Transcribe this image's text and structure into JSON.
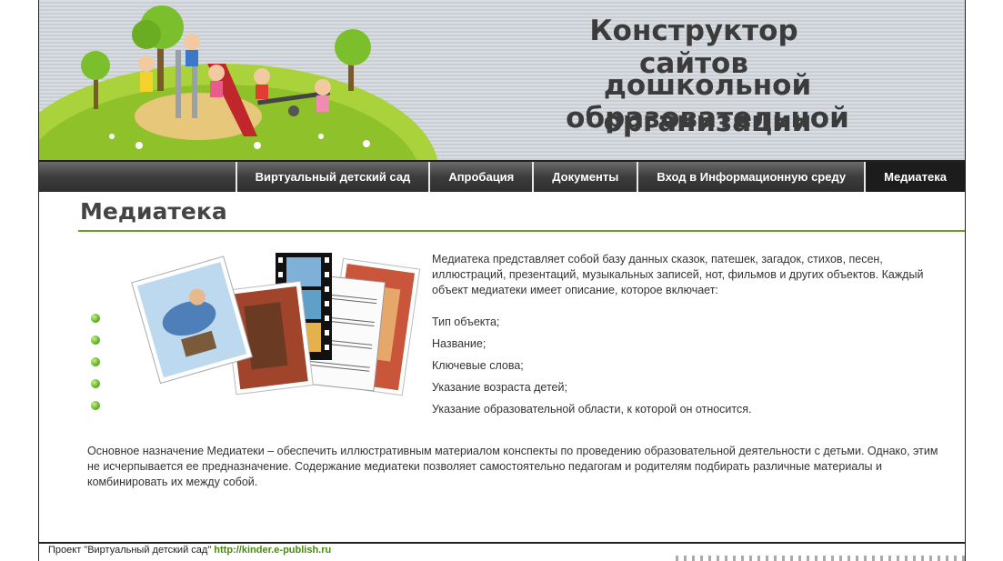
{
  "header": {
    "title_line1": "Конструктор сайтов",
    "title_line2": "дошкольной образовательной",
    "title_line3": "организации"
  },
  "nav": {
    "items": [
      {
        "label": "Виртуальный детский сад",
        "active": false
      },
      {
        "label": "Апробация",
        "active": false
      },
      {
        "label": "Документы",
        "active": false
      },
      {
        "label": "Вход в Информационную среду",
        "active": false
      },
      {
        "label": "Медиатека",
        "active": true
      }
    ]
  },
  "main": {
    "page_title": "Медиатека",
    "description": "Медиатека представляет собой базу данных сказок, патешек, загадок, стихов, песен, иллюстраций, презентаций, музыкальных записей, нот, фильмов и других объектов. Каждый объект медиатеки имеет описание, которое включает:",
    "list": [
      "Тип объекта;",
      "Название;",
      "Ключевые слова;",
      "Указание  возраста детей;",
      "Указание образовательной области, к которой он относится."
    ],
    "paragraph": "Основное назначение Медиатеки – обеспечить иллюстративным  материалом конспекты по проведению образовательной деятельности с детьми. Однако, этим не исчерпывается ее предназначение. Содержание  медиатеки  позволяет  самостоятельно педагогам и родителям подбирать различные материалы и комбинировать их между собой."
  },
  "footer": {
    "project_text": "Проект \"Виртуальный детский сад\"",
    "link": "http://kinder.e-publish.ru"
  },
  "colors": {
    "accent_green": "#6aa025",
    "nav_dark": "#3c3c3c",
    "title_gray": "#3b3b3b"
  }
}
